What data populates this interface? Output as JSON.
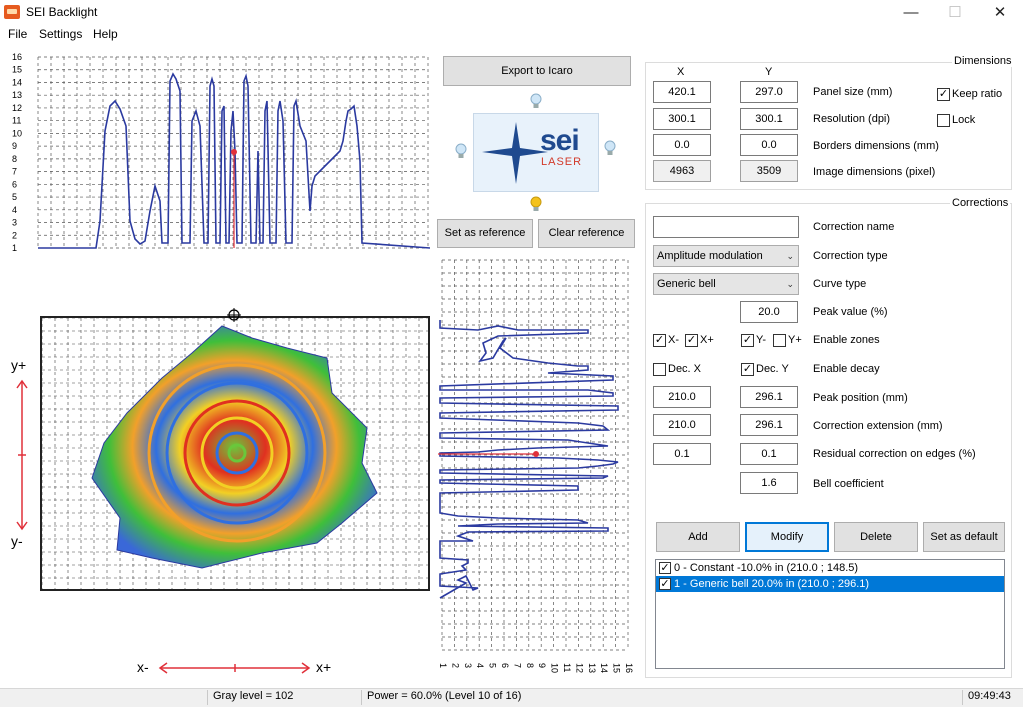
{
  "window": {
    "title": "SEI Backlight",
    "minimize": "—",
    "maximize": "☐",
    "close": "✕"
  },
  "menu": [
    "File",
    "Settings",
    "Help"
  ],
  "top_plot": {
    "y_ticks": [
      "16",
      "15",
      "14",
      "13",
      "12",
      "11",
      "10",
      "9",
      "8",
      "7",
      "6",
      "5",
      "4",
      "3",
      "2",
      "1"
    ]
  },
  "right_plot": {
    "x_ticks": [
      "1",
      "2",
      "3",
      "4",
      "5",
      "6",
      "7",
      "8",
      "9",
      "10",
      "11",
      "12",
      "13",
      "14",
      "15",
      "16"
    ]
  },
  "image_view": {
    "y_plus": "y+",
    "y_minus": "y-",
    "x_minus": "x-",
    "x_plus": "x+"
  },
  "buttons": {
    "export": "Export to Icaro",
    "set_reference": "Set as reference",
    "clear_reference": "Clear reference",
    "add": "Add",
    "modify": "Modify",
    "delete": "Delete",
    "set_default": "Set as default"
  },
  "logo": {
    "sei": "sei",
    "laser": "LASER"
  },
  "dimensions": {
    "title": "Dimensions",
    "col_x": "X",
    "col_y": "Y",
    "rows": [
      {
        "label": "Panel size (mm)",
        "x": "420.1",
        "y": "297.0"
      },
      {
        "label": "Resolution (dpi)",
        "x": "300.1",
        "y": "300.1"
      },
      {
        "label": "Borders dimensions (mm)",
        "x": "0.0",
        "y": "0.0"
      },
      {
        "label": "Image dimensions (pixel)",
        "x": "4963",
        "y": "3509"
      }
    ],
    "keep_ratio": "Keep ratio",
    "keep_ratio_checked": true,
    "lock": "Lock",
    "lock_checked": false
  },
  "corrections": {
    "title": "Corrections",
    "name_label": "Correction name",
    "name_value": "",
    "type_label": "Correction type",
    "type_value": "Amplitude modulation",
    "curve_label": "Curve type",
    "curve_value": "Generic bell",
    "peak_value_label": "Peak value (%)",
    "peak_value": "20.0",
    "enable_zones_label": "Enable zones",
    "zones": {
      "x_minus": "X-",
      "x_plus": "X+",
      "y_minus": "Y-",
      "y_plus": "Y+"
    },
    "zones_checked": {
      "x_minus": true,
      "x_plus": true,
      "y_minus": true,
      "y_plus": false
    },
    "enable_decay_label": "Enable decay",
    "dec_x": "Dec. X",
    "dec_y": "Dec. Y",
    "dec_x_checked": false,
    "dec_y_checked": true,
    "peak_position_label": "Peak position (mm)",
    "peak_position_x": "210.0",
    "peak_position_y": "296.1",
    "extension_label": "Correction extension (mm)",
    "extension_x": "210.0",
    "extension_y": "296.1",
    "residual_label": "Residual correction on edges (%)",
    "residual_x": "0.1",
    "residual_y": "0.1",
    "bell_label": "Bell coefficient",
    "bell_value": "1.6",
    "list": [
      {
        "text": "0 - Constant -10.0% in (210.0 ; 148.5)",
        "checked": true,
        "selected": false
      },
      {
        "text": "1 - Generic bell 20.0% in (210.0 ; 296.1)",
        "checked": true,
        "selected": true
      }
    ]
  },
  "status": {
    "gray_level": "Gray level = 102",
    "power": "Power = 60.0% (Level 10 of 16)",
    "time": "09:49:43"
  },
  "colors": {
    "plot_line": "#2b3aa0",
    "marker": "#e0303a",
    "selection": "#0078d7"
  }
}
